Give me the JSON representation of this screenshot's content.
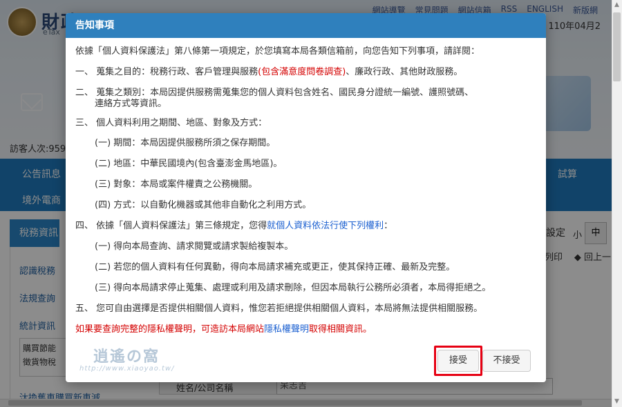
{
  "site": {
    "title_fragment": "財政",
    "subtitle_fragment": "eTax",
    "top_links": [
      "網站導覽",
      "常見問題",
      "網站信箱",
      "RSS",
      "ENGLISH",
      "新版網"
    ],
    "date_text": "期：110年04月2",
    "visitor_text": "訪客人次:9593",
    "nav": {
      "item1": "公告訊息",
      "item2": "境外電商",
      "right_item": "試算"
    },
    "sidebar": {
      "header": "稅務資訊",
      "links": [
        "認識稅務",
        "法規查詢",
        "統計資訊"
      ],
      "box_text": [
        "購買節能",
        "徵貨物稅"
      ],
      "bottom_link": "汰換舊車購買新車減"
    },
    "settings": {
      "label": "設定",
      "small": "小",
      "medium": "中",
      "print": "列印",
      "back": "回上一"
    },
    "form": {
      "label": "姓名/公司名稱",
      "value": "呆志吉"
    }
  },
  "modal": {
    "title": "告知事項",
    "intro": "依據「個人資料保護法」第八條第一項規定，於您填寫本局各類信箱前，向您告知下列事項，請詳閱：",
    "item1_prefix": "一、 蒐集之目的：稅務行政、客戶管理與服務",
    "item1_red": "(包含滿意度問卷調查)",
    "item1_suffix": "、廉政行政、其他財政服務。",
    "item2_line1": "二、 蒐集之類別：本局因提供服務需蒐集您的個人資料包含姓名、國民身分證統一編號、護照號碼、",
    "item2_line2": "連絡方式等資訊。",
    "item3": "三、 個人資料利用之期間、地區、對象及方式：",
    "item3_sub1": "(一) 期間：本局因提供服務所須之保存期間。",
    "item3_sub2": "(二) 地區：中華民國境內(包含臺澎金馬地區)。",
    "item3_sub3": "(三) 對象：本局或案件權責之公務機關。",
    "item3_sub4": "(四) 方式：以自動化機器或其他非自動化之利用方式。",
    "item4_prefix": "四、 依據「個人資料保護法」第三條規定，您得",
    "item4_link": "就個人資料依法行使下列權利",
    "item4_suffix": "：",
    "item4_sub1": "(一) 得向本局查詢、請求閱覽或請求製給複製本。",
    "item4_sub2": "(二) 若您的個人資料有任何異動，得向本局請求補充或更正，使其保持正確、最新及完整。",
    "item4_sub3": "(三) 得向本局請求停止蒐集、處理或利用及請求刪除，但因本局執行公務所必須者，本局得拒絕之。",
    "item5": "五、 您可自由選擇是否提供相關個人資料，惟您若拒絕提供相關個人資料，本局將無法提供相關服務。",
    "privacy_red1": "如果要查詢完整的隱私權聲明，可造訪本局網站",
    "privacy_link": "隱私權聲明",
    "privacy_red2": "取得相關資訊。",
    "accept_label": "接受",
    "decline_label": "不接受"
  },
  "watermark": {
    "main": "逍遙の窩",
    "url": "http://www.xiaoyao.tw/"
  },
  "colors": {
    "modal_header": "#2f80bd",
    "nav": "#1f7bbf",
    "highlight": "#e60012",
    "red_text": "#d40000",
    "link_text": "#1a5fd0"
  }
}
